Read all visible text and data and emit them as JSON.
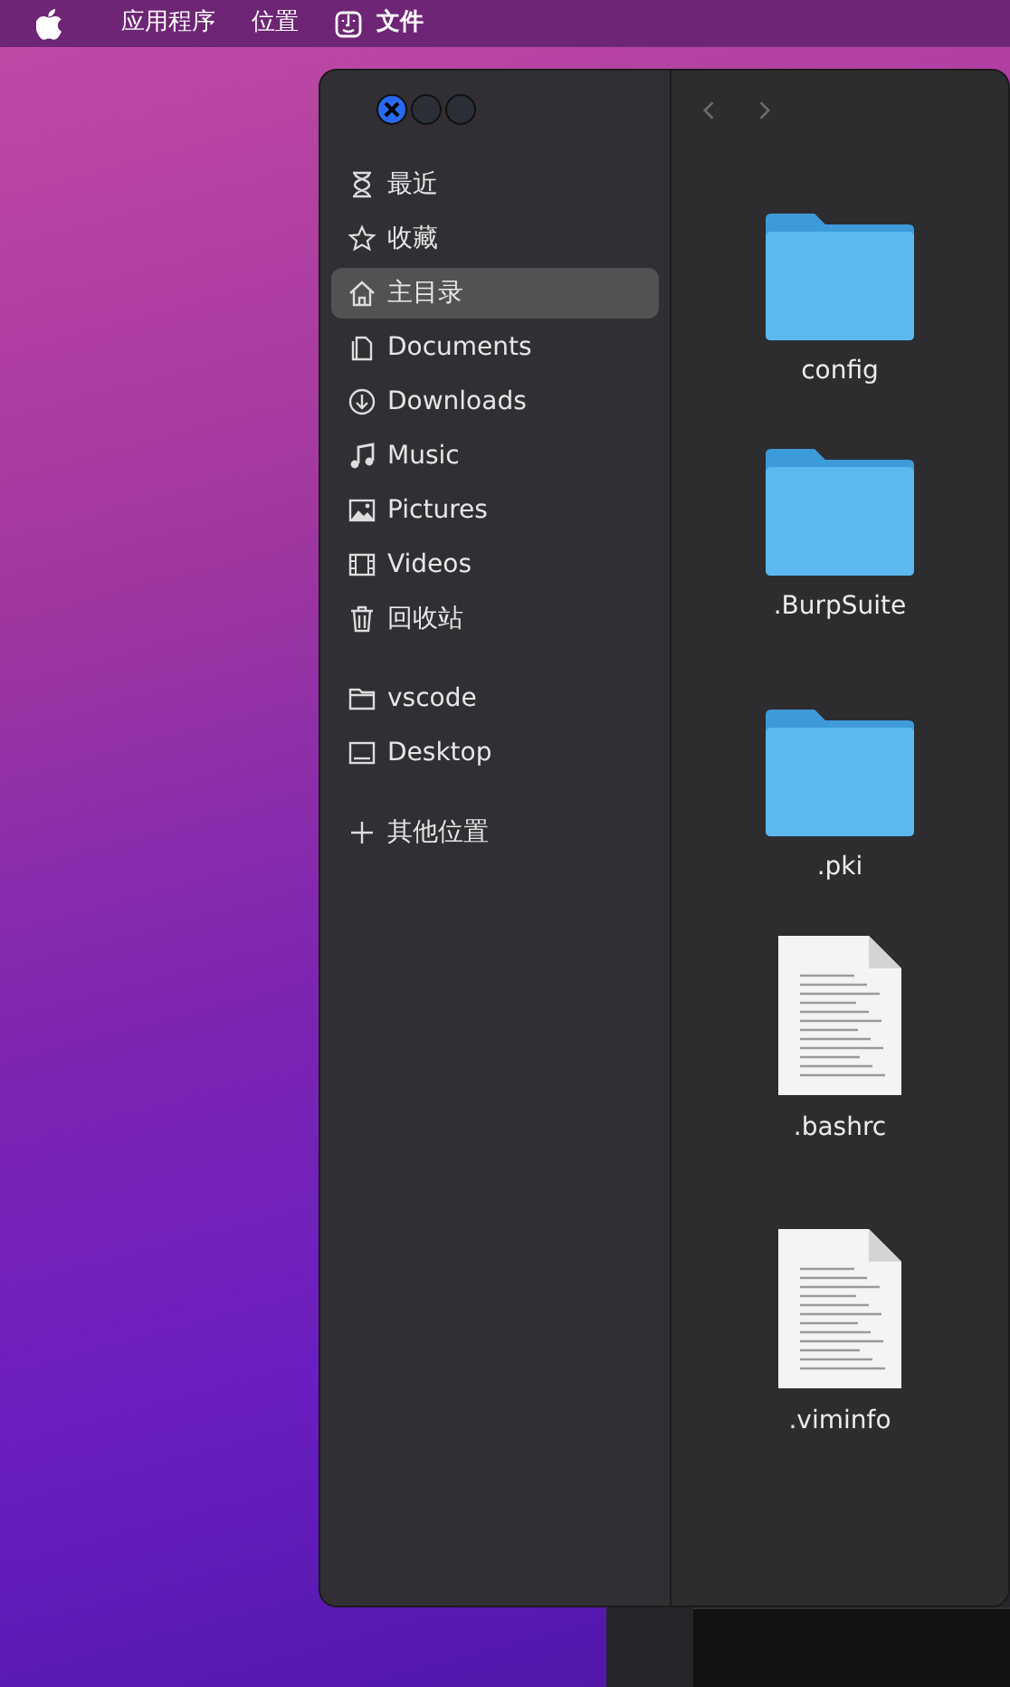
{
  "menubar": {
    "items": [
      {
        "label": "应用程序"
      },
      {
        "label": "位置"
      }
    ],
    "app": {
      "label": "文件"
    }
  },
  "window": {
    "nav": {
      "back_disabled": true,
      "forward_disabled": true
    },
    "sidebar": {
      "places": [
        {
          "label": "最近",
          "selected": false
        },
        {
          "label": "收藏",
          "selected": false
        },
        {
          "label": "主目录",
          "selected": true
        },
        {
          "label": "Documents",
          "selected": false
        },
        {
          "label": "Downloads",
          "selected": false
        },
        {
          "label": "Music",
          "selected": false
        },
        {
          "label": "Pictures",
          "selected": false
        },
        {
          "label": "Videos",
          "selected": false
        },
        {
          "label": "回收站",
          "selected": false
        }
      ],
      "bookmarks": [
        {
          "label": "vscode",
          "selected": false
        },
        {
          "label": "Desktop",
          "selected": false
        }
      ],
      "other": [
        {
          "label": "其他位置",
          "selected": false
        }
      ]
    },
    "files": [
      {
        "name": "config",
        "kind": "folder"
      },
      {
        "name": ".BurpSuite",
        "kind": "folder"
      },
      {
        "name": ".pki",
        "kind": "folder"
      },
      {
        "name": ".bashrc",
        "kind": "document"
      },
      {
        "name": ".viminfo",
        "kind": "document"
      }
    ]
  }
}
